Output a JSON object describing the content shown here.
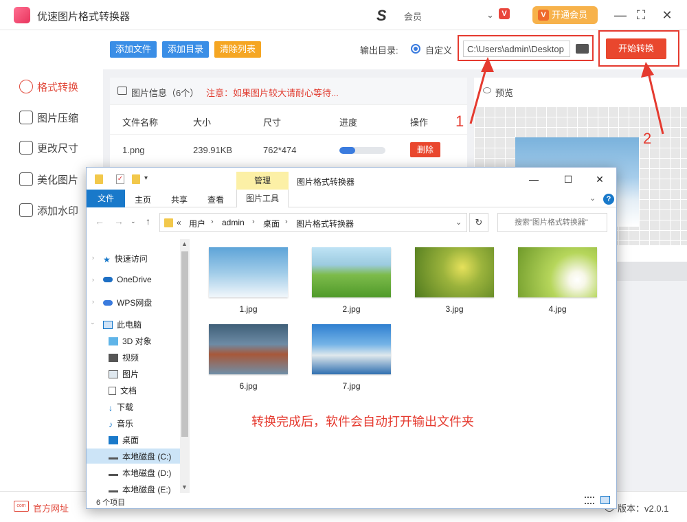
{
  "app": {
    "title": "优速图片格式转换器",
    "member_text": "会员",
    "vip_button": "开通会员",
    "vip_icon_letter": "V",
    "badge_letter": "V",
    "min": "—",
    "max": "⛶",
    "close": "✕"
  },
  "sidebar": {
    "items": [
      {
        "label": "格式转换",
        "icon": "format-convert-icon",
        "active": true
      },
      {
        "label": "图片压缩",
        "icon": "compress-icon"
      },
      {
        "label": "更改尺寸",
        "icon": "resize-icon"
      },
      {
        "label": "美化图片",
        "icon": "beautify-icon"
      },
      {
        "label": "添加水印",
        "icon": "watermark-icon"
      }
    ]
  },
  "toolbar": {
    "add_file": "添加文件",
    "add_dir": "添加目录",
    "clear_list": "清除列表",
    "output_label": "输出目录:",
    "custom_label": "自定义",
    "output_path": "C:\\Users\\admin\\Desktop",
    "start": "开始转换"
  },
  "file_list": {
    "info_label": "图片信息（6个）",
    "warning": "注意：如果图片较大请耐心等待...",
    "headers": [
      "文件名称",
      "大小",
      "尺寸",
      "进度",
      "操作"
    ],
    "rows": [
      {
        "name": "1.png",
        "size": "239.91KB",
        "dims": "762*474",
        "progress": 0.35,
        "action": "删除"
      }
    ]
  },
  "preview": {
    "label": "预览"
  },
  "annotations": {
    "step1": "1",
    "step2": "2"
  },
  "bottom": {
    "site_icon_text": "com",
    "site_label": "官方网址",
    "version": "版本：v2.0.1"
  },
  "explorer": {
    "manage_tab": "管理",
    "window_title": "图片格式转换器",
    "tabs": [
      "文件",
      "主页",
      "共享",
      "查看"
    ],
    "tools_tab": "图片工具",
    "breadcrumb": [
      "用户",
      "admin",
      "桌面",
      "图片格式转换器"
    ],
    "breadcrumb_prefix": "«",
    "search_placeholder": "搜索\"图片格式转换器\"",
    "nav": [
      {
        "label": "快速访问",
        "icon": "star-icon"
      },
      {
        "label": "OneDrive",
        "icon": "cloud-icon"
      },
      {
        "label": "WPS网盘",
        "icon": "wps-cloud-icon"
      },
      {
        "label": "此电脑",
        "icon": "computer-icon"
      },
      {
        "label": "3D 对象",
        "icon": "cube-icon"
      },
      {
        "label": "视频",
        "icon": "video-icon"
      },
      {
        "label": "图片",
        "icon": "picture-icon"
      },
      {
        "label": "文档",
        "icon": "document-icon"
      },
      {
        "label": "下载",
        "icon": "download-icon"
      },
      {
        "label": "音乐",
        "icon": "music-icon"
      },
      {
        "label": "桌面",
        "icon": "desktop-icon"
      },
      {
        "label": "本地磁盘 (C:)",
        "icon": "drive-icon",
        "selected": true
      },
      {
        "label": "本地磁盘 (D:)",
        "icon": "drive-icon"
      },
      {
        "label": "本地磁盘 (E:)",
        "icon": "drive-icon"
      }
    ],
    "files": [
      {
        "name": "1.jpg",
        "color": "#9cc8e6"
      },
      {
        "name": "2.jpg",
        "color": "#7dbb4a"
      },
      {
        "name": "3.jpg",
        "color": "#7c9b2e"
      },
      {
        "name": "4.jpg",
        "color": "#9bc247"
      },
      {
        "name": "6.jpg",
        "color": "#4a6d8a"
      },
      {
        "name": "7.jpg",
        "color": "#3f8dd6"
      }
    ],
    "note": "转换完成后，软件会自动打开输出文件夹",
    "status": "6 个项目"
  },
  "colors": {
    "accent": "#e9472e",
    "blue": "#3a7bde",
    "orange_btn": "#f5a623"
  }
}
